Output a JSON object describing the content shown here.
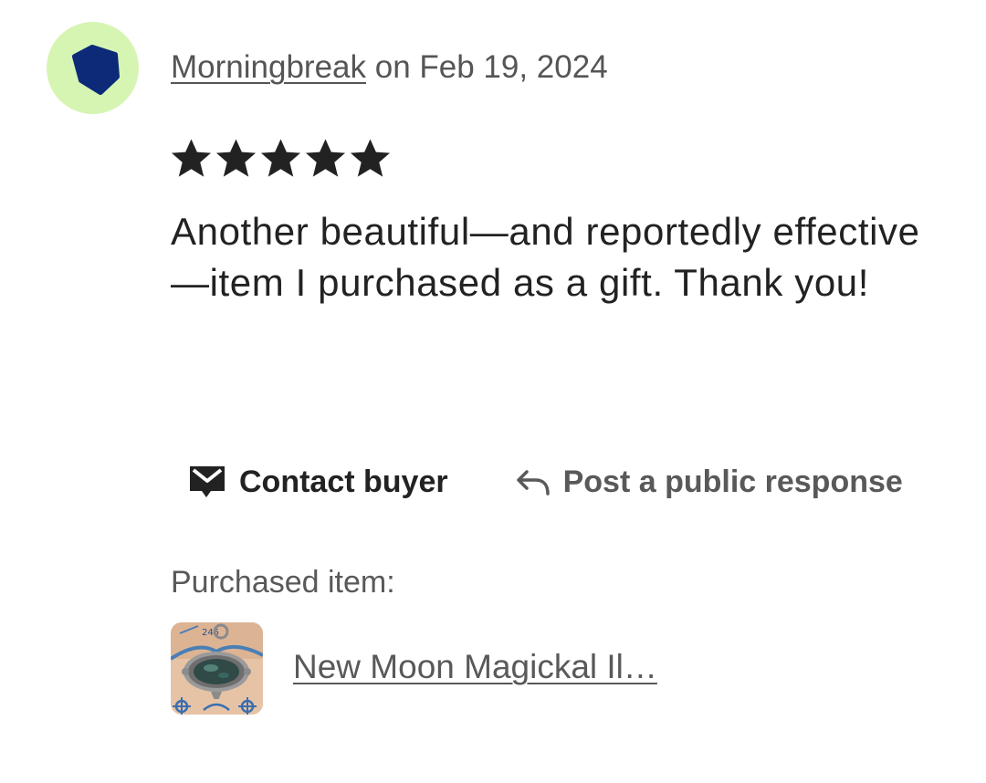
{
  "review": {
    "reviewer": {
      "name": "Morningbreak",
      "avatar_icon": "blue-pentagon-icon",
      "avatar_bg": "#d6f5b3",
      "avatar_fg": "#0d2a78"
    },
    "date_prefix": " on ",
    "date": "Feb 19, 2024",
    "rating": 5,
    "rating_max": 5,
    "text": "Another beautiful—and reportedly effective—item I purchased as a gift. Thank you!"
  },
  "actions": {
    "contact": {
      "label": "Contact buyer",
      "icon": "envelope-icon"
    },
    "respond": {
      "label": "Post a public response",
      "icon": "reply-arrow-icon"
    }
  },
  "purchased": {
    "label": "Purchased item:",
    "item_title": "New Moon Magickal Il…",
    "thumbnail_icon": "pendant-photo-thumbnail"
  }
}
